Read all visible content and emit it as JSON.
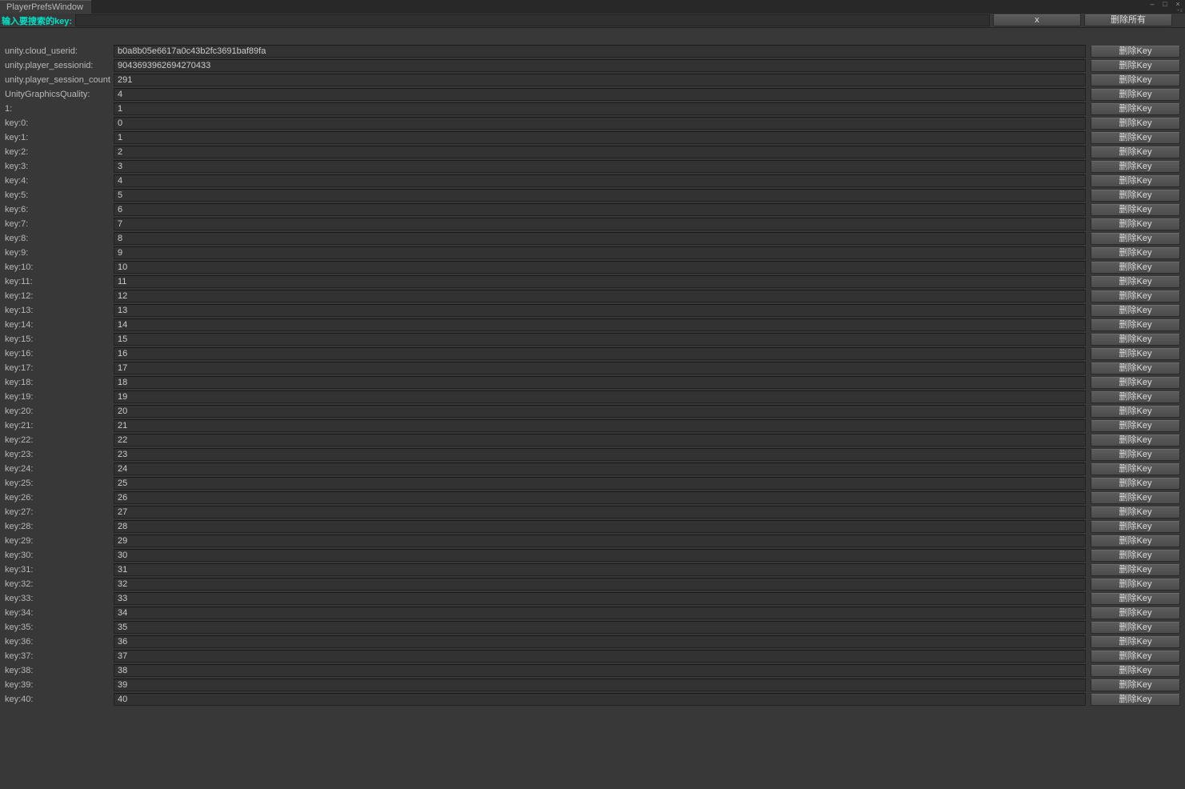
{
  "window": {
    "title": "PlayerPrefsWindow"
  },
  "search": {
    "label": "输入要搜索的key:",
    "value": "",
    "clear_label": "x",
    "delete_all_label": "删除所有"
  },
  "delete_key_label": "删除Key",
  "rows": [
    {
      "key": "unity.cloud_userid:",
      "value": "b0a8b05e6617a0c43b2fc3691baf89fa"
    },
    {
      "key": "unity.player_sessionid:",
      "value": "9043693962694270433"
    },
    {
      "key": "unity.player_session_count",
      "value": "291"
    },
    {
      "key": "UnityGraphicsQuality:",
      "value": "4"
    },
    {
      "key": "1:",
      "value": "1"
    },
    {
      "key": "key:0:",
      "value": "0"
    },
    {
      "key": "key:1:",
      "value": "1"
    },
    {
      "key": "key:2:",
      "value": "2"
    },
    {
      "key": "key:3:",
      "value": "3"
    },
    {
      "key": "key:4:",
      "value": "4"
    },
    {
      "key": "key:5:",
      "value": "5"
    },
    {
      "key": "key:6:",
      "value": "6"
    },
    {
      "key": "key:7:",
      "value": "7"
    },
    {
      "key": "key:8:",
      "value": "8"
    },
    {
      "key": "key:9:",
      "value": "9"
    },
    {
      "key": "key:10:",
      "value": "10"
    },
    {
      "key": "key:11:",
      "value": "11"
    },
    {
      "key": "key:12:",
      "value": "12"
    },
    {
      "key": "key:13:",
      "value": "13"
    },
    {
      "key": "key:14:",
      "value": "14"
    },
    {
      "key": "key:15:",
      "value": "15"
    },
    {
      "key": "key:16:",
      "value": "16"
    },
    {
      "key": "key:17:",
      "value": "17"
    },
    {
      "key": "key:18:",
      "value": "18"
    },
    {
      "key": "key:19:",
      "value": "19"
    },
    {
      "key": "key:20:",
      "value": "20"
    },
    {
      "key": "key:21:",
      "value": "21"
    },
    {
      "key": "key:22:",
      "value": "22"
    },
    {
      "key": "key:23:",
      "value": "23"
    },
    {
      "key": "key:24:",
      "value": "24"
    },
    {
      "key": "key:25:",
      "value": "25"
    },
    {
      "key": "key:26:",
      "value": "26"
    },
    {
      "key": "key:27:",
      "value": "27"
    },
    {
      "key": "key:28:",
      "value": "28"
    },
    {
      "key": "key:29:",
      "value": "29"
    },
    {
      "key": "key:30:",
      "value": "30"
    },
    {
      "key": "key:31:",
      "value": "31"
    },
    {
      "key": "key:32:",
      "value": "32"
    },
    {
      "key": "key:33:",
      "value": "33"
    },
    {
      "key": "key:34:",
      "value": "34"
    },
    {
      "key": "key:35:",
      "value": "35"
    },
    {
      "key": "key:36:",
      "value": "36"
    },
    {
      "key": "key:37:",
      "value": "37"
    },
    {
      "key": "key:38:",
      "value": "38"
    },
    {
      "key": "key:39:",
      "value": "39"
    },
    {
      "key": "key:40:",
      "value": "40"
    }
  ]
}
